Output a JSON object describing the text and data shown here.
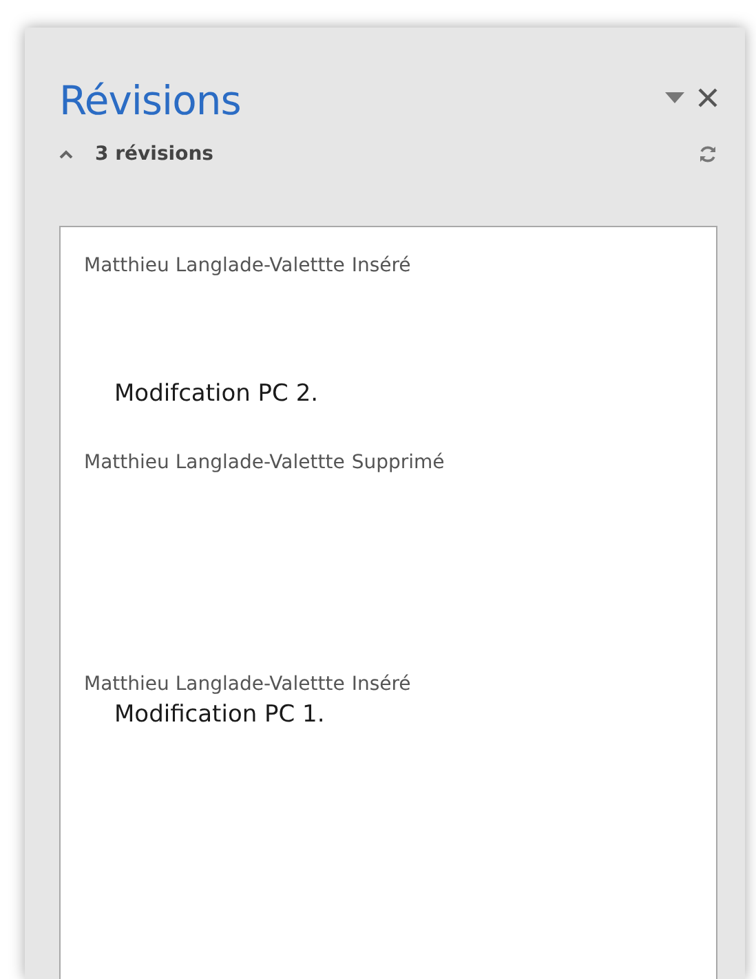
{
  "pane": {
    "title": "Révisions",
    "summary": {
      "label": "3 révisions",
      "expanded": true
    }
  },
  "revisions": [
    {
      "author": "Matthieu Langlade-Valettte",
      "action": "Inséré",
      "text": "Modifcation PC 2."
    },
    {
      "author": "Matthieu Langlade-Valettte",
      "action": "Supprimé"
    },
    {
      "author": "Matthieu Langlade-Valettte",
      "action": "Inséré",
      "text": "Modification PC 1."
    }
  ]
}
